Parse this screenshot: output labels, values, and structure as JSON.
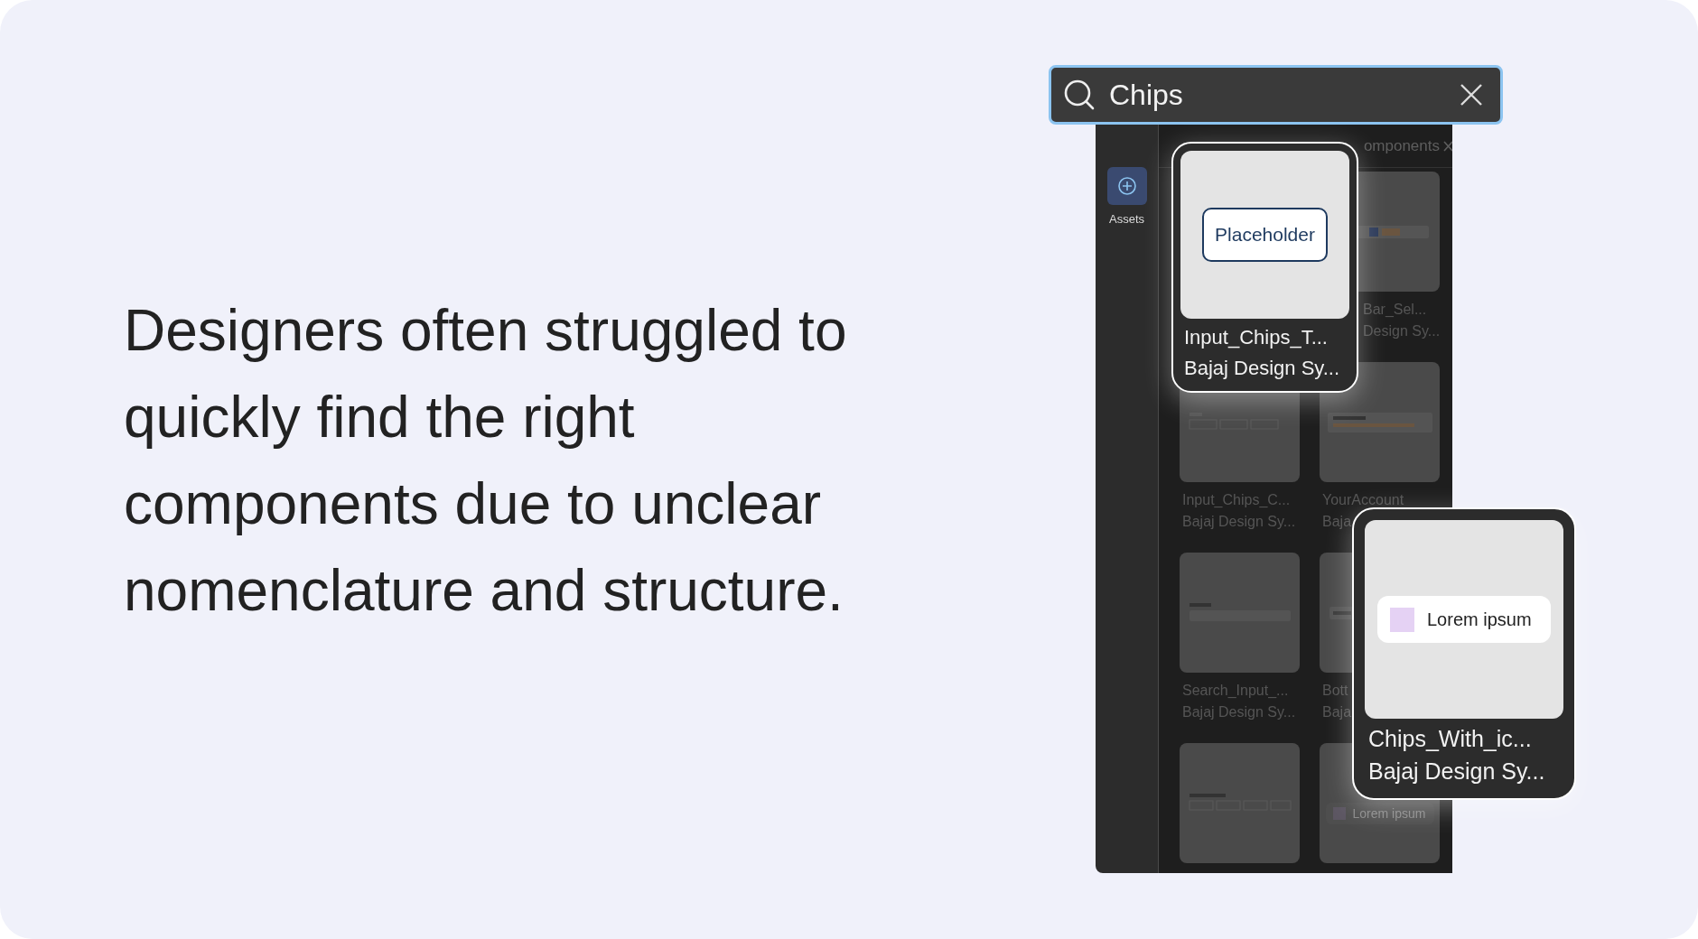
{
  "headline": "Designers often struggled to quickly find the right components due to unclear nomenclature and structure.",
  "search": {
    "value": "Chips"
  },
  "sidebar": {
    "items": [
      {
        "label": "Assets",
        "selected": true
      }
    ]
  },
  "panel": {
    "tab_label": "omponents"
  },
  "results": [
    {
      "name": "Bar_Sel...",
      "library": "Design Sy...",
      "kind": "toolbar"
    },
    {
      "name": "Input_Chips_C...",
      "library": "Bajaj Design Sy...",
      "kind": "chips"
    },
    {
      "name": "YourAccount",
      "library": "Baja",
      "kind": "account"
    },
    {
      "name": "Search_Input_...",
      "library": "Bajaj Design Sy...",
      "kind": "input"
    },
    {
      "name": "Bott",
      "library": "Baja",
      "kind": "field"
    },
    {
      "kind": "ids"
    },
    {
      "kind": "chip",
      "preview_text": "Lorem ipsum"
    }
  ],
  "popups": [
    {
      "name": "Input_Chips_T...",
      "library": "Bajaj Design Sy...",
      "kind": "outline",
      "chip_text": "Placeholder"
    },
    {
      "name": "Chips_With_ic...",
      "library": "Bajaj Design Sy...",
      "kind": "icon",
      "chip_text": "Lorem ipsum"
    }
  ]
}
